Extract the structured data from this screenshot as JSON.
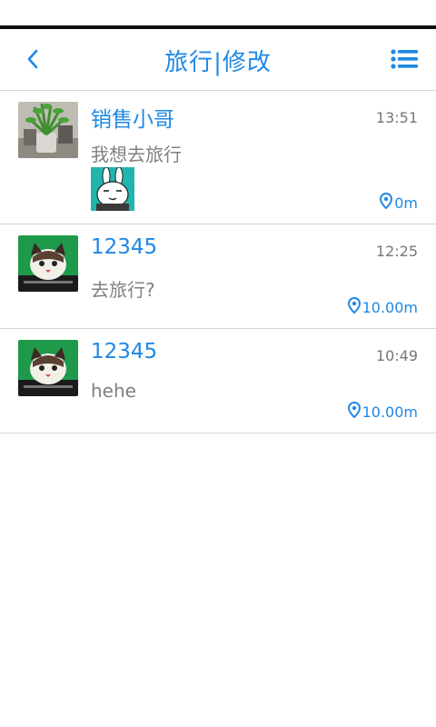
{
  "header": {
    "title": "旅行|修改",
    "back_icon": "chevron-left-icon",
    "menu_icon": "list-menu-icon"
  },
  "colors": {
    "accent": "#1e88e5",
    "secondary_text": "#808080",
    "divider": "#d6d6d6"
  },
  "messages": [
    {
      "name": "销售小哥",
      "time": "13:51",
      "text": "我想去旅行",
      "has_sticker": true,
      "distance": "0m",
      "avatar": "plant-avatar"
    },
    {
      "name": "12345",
      "time": "12:25",
      "text": "去旅行?",
      "has_sticker": false,
      "distance": "10.00m",
      "avatar": "cat-avatar"
    },
    {
      "name": "12345",
      "time": "10:49",
      "text": "hehe",
      "has_sticker": false,
      "distance": "10.00m",
      "avatar": "cat-avatar"
    }
  ]
}
